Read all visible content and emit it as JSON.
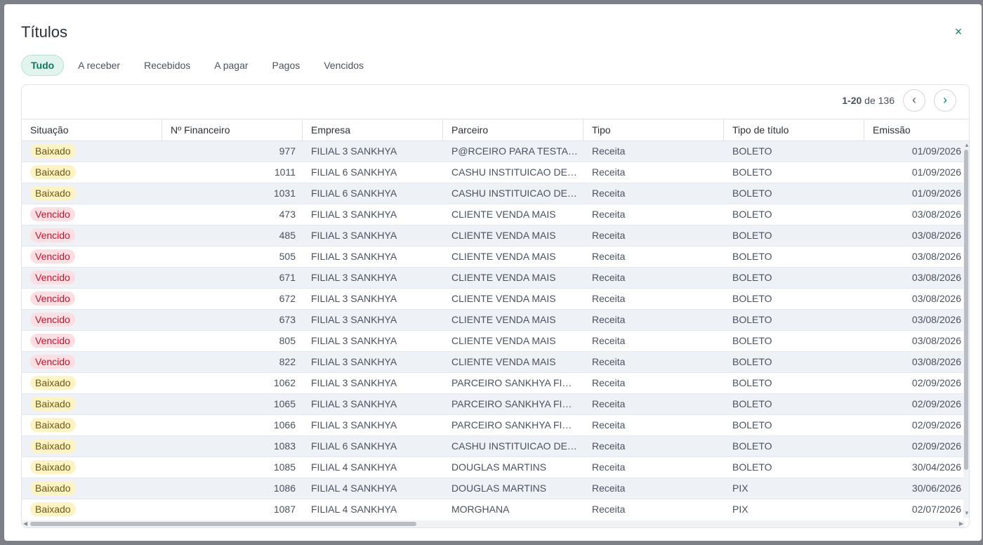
{
  "modal": {
    "title": "Títulos",
    "close_label": "×"
  },
  "tabs": [
    {
      "label": "Tudo",
      "active": true
    },
    {
      "label": "A receber",
      "active": false
    },
    {
      "label": "Recebidos",
      "active": false
    },
    {
      "label": "A pagar",
      "active": false
    },
    {
      "label": "Pagos",
      "active": false
    },
    {
      "label": "Vencidos",
      "active": false
    }
  ],
  "pager": {
    "range": "1-20",
    "of_label": "de",
    "total": "136",
    "prev_icon": "‹",
    "next_icon": "›"
  },
  "columns": [
    "Situação",
    "Nº Financeiro",
    "Empresa",
    "Parceiro",
    "Tipo",
    "Tipo de título",
    "Emissão"
  ],
  "rows": [
    {
      "situacao": "Baixado",
      "numero": "977",
      "empresa": "FILIAL 3 SANKHYA",
      "parceiro": "P@RCEIRO PARA TESTAR ...",
      "tipo": "Receita",
      "tipo_titulo": "BOLETO",
      "emissao": "01/09/2026"
    },
    {
      "situacao": "Baixado",
      "numero": "1011",
      "empresa": "FILIAL 6 SANKHYA",
      "parceiro": "CASHU INSTITUICAO DE P...",
      "tipo": "Receita",
      "tipo_titulo": "BOLETO",
      "emissao": "01/09/2026"
    },
    {
      "situacao": "Baixado",
      "numero": "1031",
      "empresa": "FILIAL 6 SANKHYA",
      "parceiro": "CASHU INSTITUICAO DE P...",
      "tipo": "Receita",
      "tipo_titulo": "BOLETO",
      "emissao": "01/09/2026"
    },
    {
      "situacao": "Vencido",
      "numero": "473",
      "empresa": "FILIAL 3 SANKHYA",
      "parceiro": "CLIENTE VENDA MAIS",
      "tipo": "Receita",
      "tipo_titulo": "BOLETO",
      "emissao": "03/08/2026"
    },
    {
      "situacao": "Vencido",
      "numero": "485",
      "empresa": "FILIAL 3 SANKHYA",
      "parceiro": "CLIENTE VENDA MAIS",
      "tipo": "Receita",
      "tipo_titulo": "BOLETO",
      "emissao": "03/08/2026"
    },
    {
      "situacao": "Vencido",
      "numero": "505",
      "empresa": "FILIAL 3 SANKHYA",
      "parceiro": "CLIENTE VENDA MAIS",
      "tipo": "Receita",
      "tipo_titulo": "BOLETO",
      "emissao": "03/08/2026"
    },
    {
      "situacao": "Vencido",
      "numero": "671",
      "empresa": "FILIAL 3 SANKHYA",
      "parceiro": "CLIENTE VENDA MAIS",
      "tipo": "Receita",
      "tipo_titulo": "BOLETO",
      "emissao": "03/08/2026"
    },
    {
      "situacao": "Vencido",
      "numero": "672",
      "empresa": "FILIAL 3 SANKHYA",
      "parceiro": "CLIENTE VENDA MAIS",
      "tipo": "Receita",
      "tipo_titulo": "BOLETO",
      "emissao": "03/08/2026"
    },
    {
      "situacao": "Vencido",
      "numero": "673",
      "empresa": "FILIAL 3 SANKHYA",
      "parceiro": "CLIENTE VENDA MAIS",
      "tipo": "Receita",
      "tipo_titulo": "BOLETO",
      "emissao": "03/08/2026"
    },
    {
      "situacao": "Vencido",
      "numero": "805",
      "empresa": "FILIAL 3 SANKHYA",
      "parceiro": "CLIENTE VENDA MAIS",
      "tipo": "Receita",
      "tipo_titulo": "BOLETO",
      "emissao": "03/08/2026"
    },
    {
      "situacao": "Vencido",
      "numero": "822",
      "empresa": "FILIAL 3 SANKHYA",
      "parceiro": "CLIENTE VENDA MAIS",
      "tipo": "Receita",
      "tipo_titulo": "BOLETO",
      "emissao": "03/08/2026"
    },
    {
      "situacao": "Baixado",
      "numero": "1062",
      "empresa": "FILIAL 3 SANKHYA",
      "parceiro": "PARCEIRO SANKHYA FINA...",
      "tipo": "Receita",
      "tipo_titulo": "BOLETO",
      "emissao": "02/09/2026"
    },
    {
      "situacao": "Baixado",
      "numero": "1065",
      "empresa": "FILIAL 3 SANKHYA",
      "parceiro": "PARCEIRO SANKHYA FINA...",
      "tipo": "Receita",
      "tipo_titulo": "BOLETO",
      "emissao": "02/09/2026"
    },
    {
      "situacao": "Baixado",
      "numero": "1066",
      "empresa": "FILIAL 3 SANKHYA",
      "parceiro": "PARCEIRO SANKHYA FINA...",
      "tipo": "Receita",
      "tipo_titulo": "BOLETO",
      "emissao": "02/09/2026"
    },
    {
      "situacao": "Baixado",
      "numero": "1083",
      "empresa": "FILIAL 6 SANKHYA",
      "parceiro": "CASHU INSTITUICAO DE P...",
      "tipo": "Receita",
      "tipo_titulo": "BOLETO",
      "emissao": "02/09/2026"
    },
    {
      "situacao": "Baixado",
      "numero": "1085",
      "empresa": "FILIAL 4 SANKHYA",
      "parceiro": "DOUGLAS MARTINS",
      "tipo": "Receita",
      "tipo_titulo": "BOLETO",
      "emissao": "30/04/2026"
    },
    {
      "situacao": "Baixado",
      "numero": "1086",
      "empresa": "FILIAL 4 SANKHYA",
      "parceiro": "DOUGLAS MARTINS",
      "tipo": "Receita",
      "tipo_titulo": "PIX",
      "emissao": "30/06/2026"
    },
    {
      "situacao": "Baixado",
      "numero": "1087",
      "empresa": "FILIAL 4 SANKHYA",
      "parceiro": "MORGHANA",
      "tipo": "Receita",
      "tipo_titulo": "PIX",
      "emissao": "02/07/2026"
    }
  ],
  "colors": {
    "accent": "#0a8a6a",
    "baixado_bg": "#fdf3c4",
    "vencido_bg": "#fbdfe3",
    "vencido_text": "#c4122f"
  }
}
